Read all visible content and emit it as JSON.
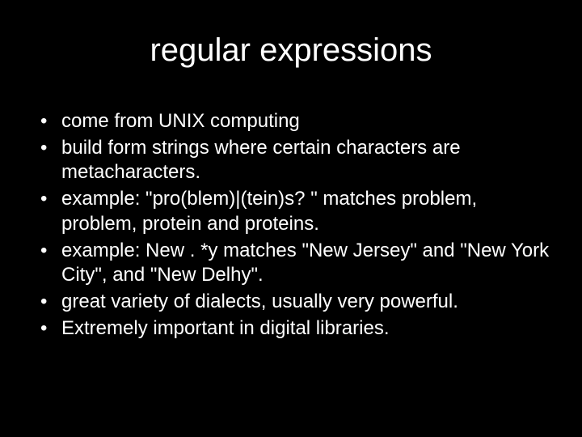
{
  "title": "regular expressions",
  "bullets": [
    "come from UNIX computing",
    "build form strings where certain characters are metacharacters.",
    "example: \"pro(blem)|(tein)s? \" matches problem, problem, protein and proteins.",
    "example: New . *y matches \"New Jersey\" and \"New York City\", and \"New Delhy\".",
    "great variety of dialects, usually very powerful.",
    "Extremely important in digital libraries."
  ]
}
